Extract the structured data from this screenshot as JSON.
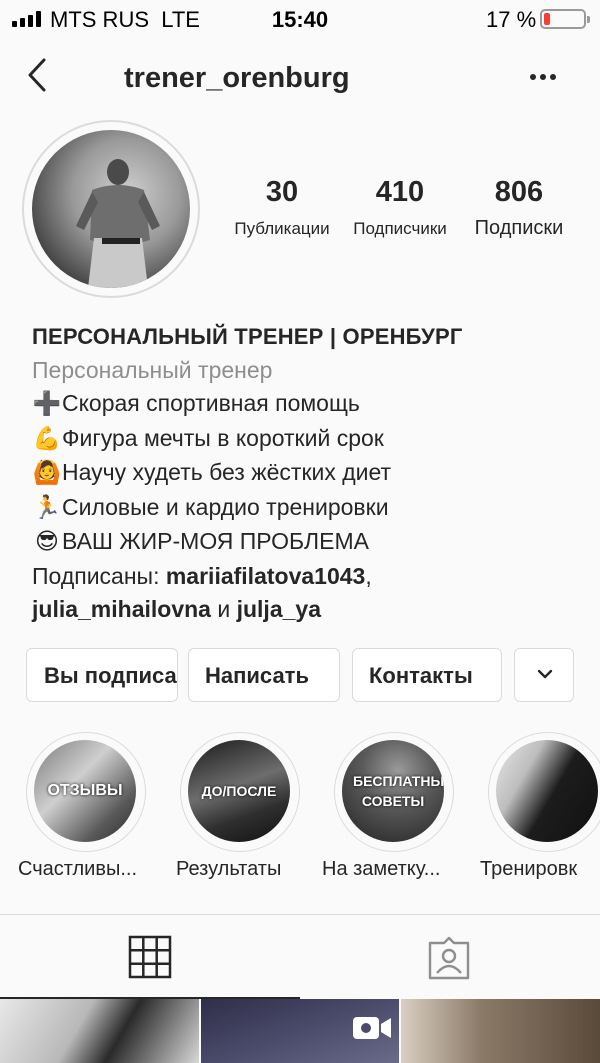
{
  "status_bar": {
    "carrier": "MTS RUS",
    "network": "LTE",
    "time": "15:40",
    "battery": "17 %",
    "battery_level_percent": 17
  },
  "nav": {
    "username": "trener_orenburg"
  },
  "stats": [
    {
      "value": "30",
      "label": "Публикации"
    },
    {
      "value": "410",
      "label": "Подписчики"
    },
    {
      "value": "806",
      "label": "Подписки"
    }
  ],
  "bio": {
    "name": "ПЕРСОНАЛЬНЫЙ ТРЕНЕР | ОРЕНБУРГ",
    "category": "Персональный тренер",
    "lines": [
      {
        "emoji": "➕",
        "text": "Скорая спортивная помощь"
      },
      {
        "emoji": "💪",
        "text": "Фигура мечты в короткий срок"
      },
      {
        "emoji": "🙆",
        "text": "Научу худеть без жёстких диет"
      },
      {
        "emoji": "🏃",
        "text": "Силовые и кардио тренировки"
      },
      {
        "emoji": "😎",
        "text": "ВАШ ЖИР-МОЯ ПРОБЛЕМА"
      }
    ],
    "followed_by_prefix": "Подписаны:",
    "followed_by": [
      "mariiafilatova1043",
      "julia_mihailovna",
      "julja_ya"
    ],
    "followed_by_sep1": ",",
    "followed_by_and": "и"
  },
  "buttons": {
    "following": "Вы подписаны",
    "message": "Написать",
    "contacts": "Контакты"
  },
  "highlights": [
    {
      "cover_text": "ОТЗЫВЫ",
      "caption": "Счастливы..."
    },
    {
      "cover_text": "ДО/ПОСЛЕ",
      "caption": "Результаты"
    },
    {
      "cover_text": "БЕСПЛАТНЫЕ СОВЕТЫ",
      "caption": "На заметку..."
    },
    {
      "cover_text": "",
      "caption": "Тренировк"
    }
  ],
  "tabs": [
    "grid-icon",
    "tagged-icon"
  ]
}
